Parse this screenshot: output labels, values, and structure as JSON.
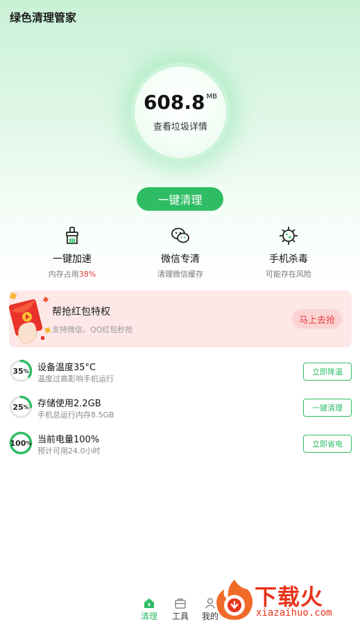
{
  "app": {
    "title": "绿色清理管家"
  },
  "junk": {
    "size": "608.8",
    "unit": "MB",
    "link": "查看垃圾详情"
  },
  "primary_button": {
    "label": "一键清理"
  },
  "features": [
    {
      "title": "一键加速",
      "sub_prefix": "内存占用",
      "sub_highlight": "38%",
      "icon": "broom-icon"
    },
    {
      "title": "微信专清",
      "sub": "清理微信缓存",
      "icon": "wechat-icon"
    },
    {
      "title": "手机杀毒",
      "sub": "可能存在风险",
      "icon": "virus-icon"
    }
  ],
  "banner": {
    "title": "帮抢红包特权",
    "sub": "支持微信、QQ红包秒抢",
    "button": "马上去抢",
    "icon": "red-envelope-icon"
  },
  "status": [
    {
      "percent_label": "35",
      "percent_sign": "%",
      "percent": 35,
      "title": "设备温度35°C",
      "sub": "温度过高影响手机运行",
      "button": "立即降温"
    },
    {
      "percent_label": "25",
      "percent_sign": "%",
      "percent": 25,
      "title": "存储使用2.2GB",
      "sub": "手机总运行内存8.5GB",
      "button": "一键清理"
    },
    {
      "percent_label": "100",
      "percent_sign": "%",
      "percent": 100,
      "title": "当前电量100%",
      "sub": "预计可用24.0小时",
      "button": "立即省电"
    }
  ],
  "tabbar": {
    "items": [
      {
        "label": "清理",
        "icon": "home-icon",
        "active": true
      },
      {
        "label": "工具",
        "icon": "toolbox-icon",
        "active": false
      },
      {
        "label": "我的",
        "icon": "user-icon",
        "active": false
      }
    ]
  },
  "watermark": {
    "main": "下载火",
    "sub": "xiazaihuo.com"
  },
  "colors": {
    "accent": "#2ebd64",
    "danger": "#e03a3a",
    "banner_bg": "#fde7e7",
    "watermark": "#e8341c"
  }
}
